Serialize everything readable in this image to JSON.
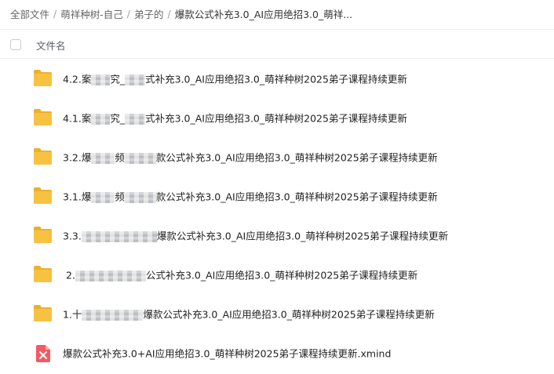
{
  "breadcrumb": {
    "items": [
      "全部文件",
      "萌祥种树-自己",
      "弟子的"
    ],
    "separator": "/",
    "current": "爆款公式补充3.0_AI应用绝招3.0_萌祥..."
  },
  "list_header": {
    "column_name": "文件名"
  },
  "files": [
    {
      "type": "folder",
      "icon": "folder-icon",
      "prefix": "4.2.案",
      "middle": "究_",
      "suffix": "式补充3.0_AI应用绝招3.0_萌祥种树2025弟子课程持续更新"
    },
    {
      "type": "folder",
      "icon": "folder-icon",
      "prefix": "4.1.案",
      "middle": "究_",
      "suffix": "式补充3.0_AI应用绝招3.0_萌祥种树2025弟子课程持续更新"
    },
    {
      "type": "folder",
      "icon": "folder-icon",
      "prefix": "3.2.爆",
      "middle": "频",
      "suffix": "款公式补充3.0_AI应用绝招3.0_萌祥种树2025弟子课程持续更新"
    },
    {
      "type": "folder",
      "icon": "folder-icon",
      "prefix": "3.1.爆",
      "middle": "频",
      "suffix": "款公式补充3.0_AI应用绝招3.0_萌祥种树2025弟子课程持续更新"
    },
    {
      "type": "folder",
      "icon": "folder-icon",
      "prefix": "3.3.",
      "middle": "",
      "suffix": "爆款公式补充3.0_AI应用绝招3.0_萌祥种树2025弟子课程持续更新"
    },
    {
      "type": "folder",
      "icon": "folder-icon",
      "prefix": "2.",
      "middle": "",
      "suffix": "公式补充3.0_AI应用绝招3.0_萌祥种树2025弟子课程持续更新"
    },
    {
      "type": "folder",
      "icon": "folder-icon",
      "prefix": "1.十",
      "middle": "",
      "suffix": "爆款公式补充3.0_AI应用绝招3.0_萌祥种树2025弟子课程持续更新"
    },
    {
      "type": "xmind",
      "icon": "xmind-file-icon",
      "prefix": "爆款公式补充3.0+AI应用绝招3.0_萌祥种树2025弟子课程持续更新.xmind",
      "middle": "",
      "suffix": ""
    }
  ],
  "colors": {
    "folder": "#F7C242",
    "folder_dark": "#EDB02E",
    "xmind": "#F25A63",
    "text": "#222222"
  }
}
